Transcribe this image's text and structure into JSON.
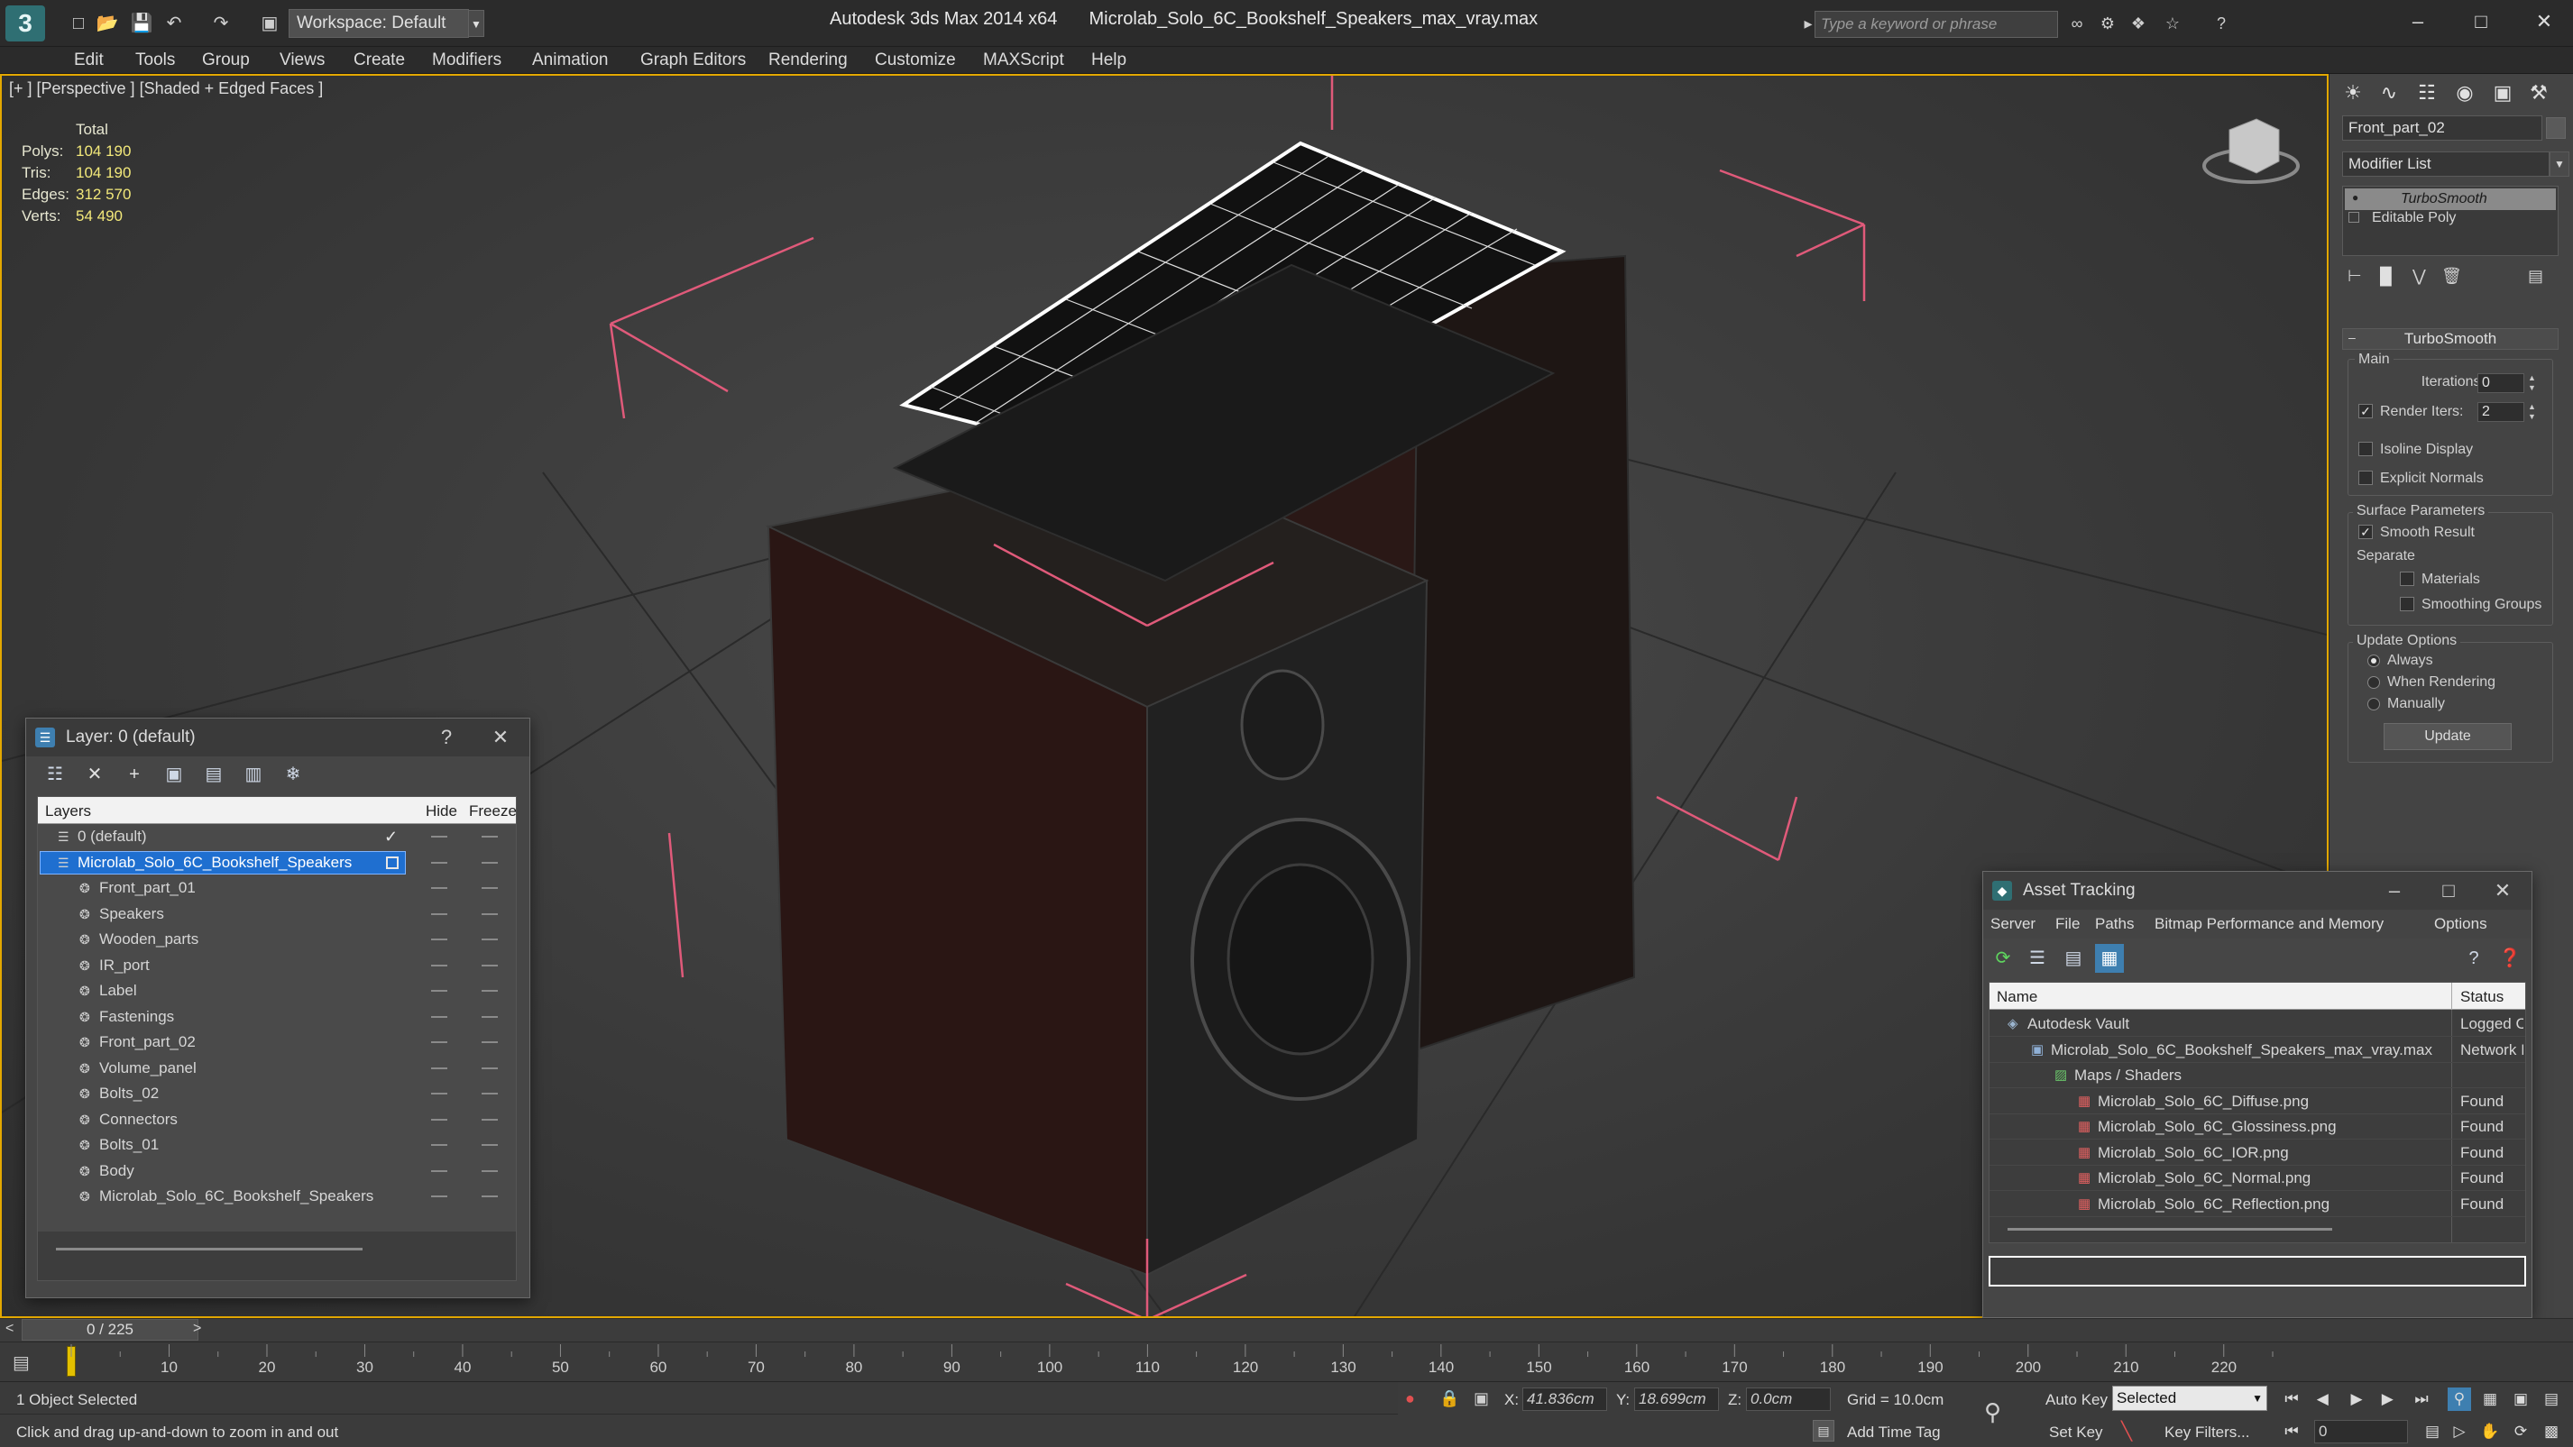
{
  "app": {
    "title": "Autodesk 3ds Max  2014 x64",
    "file": "Microlab_Solo_6C_Bookshelf_Speakers_max_vray.max",
    "workspace": "Workspace: Default",
    "search_placeholder": "Type a keyword or phrase"
  },
  "menu": [
    "Edit",
    "Tools",
    "Group",
    "Views",
    "Create",
    "Modifiers",
    "Animation",
    "Graph Editors",
    "Rendering",
    "Customize",
    "MAXScript",
    "Help"
  ],
  "viewport": {
    "label": "[+ ] [Perspective ] [Shaded + Edged Faces ]",
    "stats": {
      "header": "Total",
      "rows": [
        {
          "label": "Polys:",
          "value": "104 190"
        },
        {
          "label": "Tris:",
          "value": "104 190"
        },
        {
          "label": "Edges:",
          "value": "312 570"
        },
        {
          "label": "Verts:",
          "value": "54 490"
        }
      ]
    }
  },
  "command_panel": {
    "object_name": "Front_part_02",
    "modifier_list": "Modifier List",
    "stack": [
      "TurboSmooth",
      "Editable Poly"
    ],
    "rollout_title": "TurboSmooth",
    "main_label": "Main",
    "iterations_label": "Iterations:",
    "iterations_value": "0",
    "render_iters_label": "Render Iters:",
    "render_iters_value": "2",
    "isoline": "Isoline Display",
    "explicit_normals": "Explicit Normals",
    "surface_params": "Surface Parameters",
    "smooth_result": "Smooth Result",
    "separate": "Separate",
    "materials": "Materials",
    "smoothing_groups": "Smoothing Groups",
    "update_options": "Update Options",
    "always": "Always",
    "when_rendering": "When Rendering",
    "manually": "Manually",
    "update_button": "Update"
  },
  "layer_window": {
    "title": "Layer: 0 (default)",
    "help": "?",
    "col_layers": "Layers",
    "col_hide": "Hide",
    "col_freeze": "Freeze",
    "rows": [
      {
        "name": "0 (default)",
        "level": 0
      },
      {
        "name": "Microlab_Solo_6C_Bookshelf_Speakers",
        "level": 0
      },
      {
        "name": "Front_part_01",
        "level": 1
      },
      {
        "name": "Speakers",
        "level": 1
      },
      {
        "name": "Wooden_parts",
        "level": 1
      },
      {
        "name": "IR_port",
        "level": 1
      },
      {
        "name": "Label",
        "level": 1
      },
      {
        "name": "Fastenings",
        "level": 1
      },
      {
        "name": "Front_part_02",
        "level": 1
      },
      {
        "name": "Volume_panel",
        "level": 1
      },
      {
        "name": "Bolts_02",
        "level": 1
      },
      {
        "name": "Connectors",
        "level": 1
      },
      {
        "name": "Bolts_01",
        "level": 1
      },
      {
        "name": "Body",
        "level": 1
      },
      {
        "name": "Microlab_Solo_6C_Bookshelf_Speakers",
        "level": 1
      }
    ]
  },
  "asset_window": {
    "title": "Asset Tracking",
    "menu": [
      "Server",
      "File",
      "Paths",
      "Bitmap Performance and Memory",
      "Options"
    ],
    "col_name": "Name",
    "col_status": "Status",
    "rows": [
      {
        "name": "Autodesk Vault",
        "status": "Logged C",
        "level": 1
      },
      {
        "name": "Microlab_Solo_6C_Bookshelf_Speakers_max_vray.max",
        "status": "Network I",
        "level": 2
      },
      {
        "name": "Maps / Shaders",
        "status": "",
        "level": 3
      },
      {
        "name": "Microlab_Solo_6C_Diffuse.png",
        "status": "Found",
        "level": 4
      },
      {
        "name": "Microlab_Solo_6C_Glossiness.png",
        "status": "Found",
        "level": 4
      },
      {
        "name": "Microlab_Solo_6C_IOR.png",
        "status": "Found",
        "level": 4
      },
      {
        "name": "Microlab_Solo_6C_Normal.png",
        "status": "Found",
        "level": 4
      },
      {
        "name": "Microlab_Solo_6C_Reflection.png",
        "status": "Found",
        "level": 4
      }
    ]
  },
  "timeline": {
    "frame": "0 / 225",
    "ticks": [
      "10",
      "20",
      "30",
      "40",
      "50",
      "60",
      "70",
      "80",
      "90",
      "100",
      "110",
      "120",
      "130",
      "140",
      "150",
      "160",
      "170",
      "180",
      "190",
      "200",
      "210",
      "220"
    ],
    "frame_count": 225
  },
  "status": {
    "selected": "1 Object Selected",
    "hint": "Click and drag up-and-down to zoom in and out",
    "x_label": "X:",
    "x_value": "41.836cm",
    "y_label": "Y:",
    "y_value": "18.699cm",
    "z_label": "Z:",
    "z_value": "0.0cm",
    "grid": "Grid = 10.0cm",
    "auto_key": "Auto Key",
    "selected_set": "Selected",
    "set_key": "Set Key",
    "key_filters": "Key Filters...",
    "add_time_tag": "Add Time Tag",
    "frame_value": "0"
  }
}
